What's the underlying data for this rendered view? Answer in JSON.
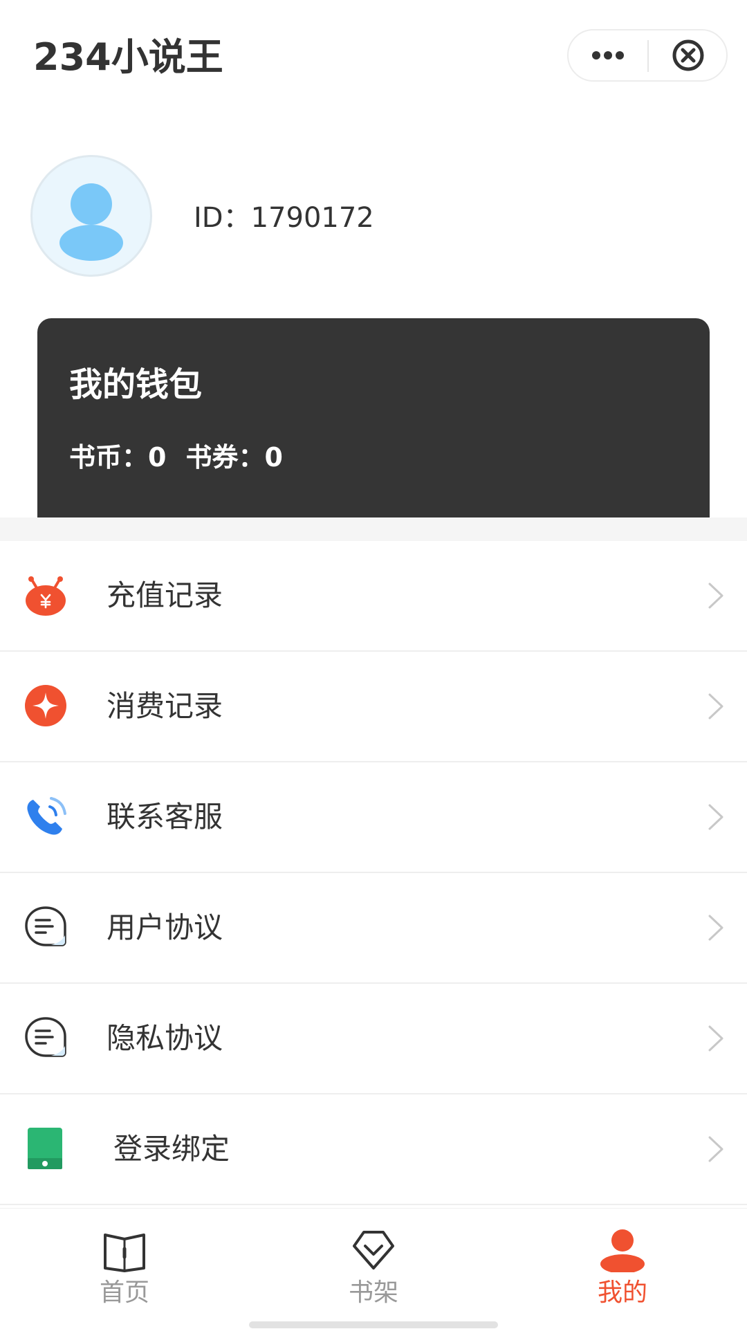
{
  "header": {
    "title": "234小说王",
    "more_icon": "more-dots-icon",
    "close_icon": "close-circle-icon"
  },
  "profile": {
    "avatar_icon": "user-avatar-icon",
    "id_text": "ID：1790172"
  },
  "wallet": {
    "title": "我的钱包",
    "coins_label": "书币：",
    "coins_value": "0",
    "vouchers_label": "书券：",
    "vouchers_value": "0",
    "background": "#353535"
  },
  "menu": {
    "items": [
      {
        "label": "充值记录",
        "icon": "recharge-wallet-icon"
      },
      {
        "label": "消费记录",
        "icon": "consumption-star-icon"
      },
      {
        "label": "联系客服",
        "icon": "phone-call-icon"
      },
      {
        "label": "用户协议",
        "icon": "document-chat-icon"
      },
      {
        "label": "隐私协议",
        "icon": "document-chat-icon"
      },
      {
        "label": "登录绑定",
        "icon": "tablet-device-icon"
      }
    ]
  },
  "tabbar": {
    "items": [
      {
        "label": "首页",
        "icon": "book-home-icon",
        "active": false
      },
      {
        "label": "书架",
        "icon": "bookshelf-diamond-icon",
        "active": false
      },
      {
        "label": "我的",
        "icon": "user-profile-icon",
        "active": true
      }
    ]
  },
  "colors": {
    "accent": "#f05130",
    "inactive_tab": "#999999",
    "phone_blue": "#2f80ed",
    "tablet_green": "#2bb673",
    "avatar_blue": "#7ac8f8"
  }
}
